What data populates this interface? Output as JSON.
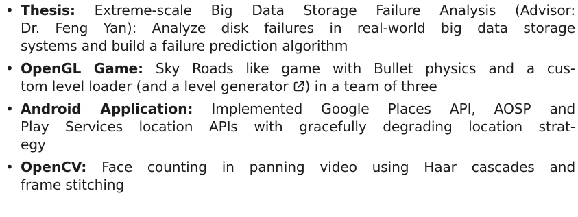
{
  "items": [
    {
      "term": "Thesis:",
      "lines": [
        "Extreme-scale Big Data Storage Failure Analysis (Advisor:",
        "Dr. Feng Yan): Analyze disk failures in real-world big data storage",
        "systems and build a failure prediction algorithm"
      ]
    },
    {
      "term": "OpenGL Game:",
      "lines": [
        "Sky Roads like game with Bullet physics and a cus-",
        "tom level loader (and a level generator",
        ") in a team of three"
      ],
      "icon": "external-link-icon"
    },
    {
      "term": "Android Application:",
      "lines": [
        "Implemented Google Places API, AOSP and",
        "Play Services location APIs with gracefully degrading location strat-",
        "egy"
      ]
    },
    {
      "term": "OpenCV:",
      "lines": [
        "Face counting in panning video using Haar cascades and",
        "frame stitching"
      ]
    }
  ]
}
